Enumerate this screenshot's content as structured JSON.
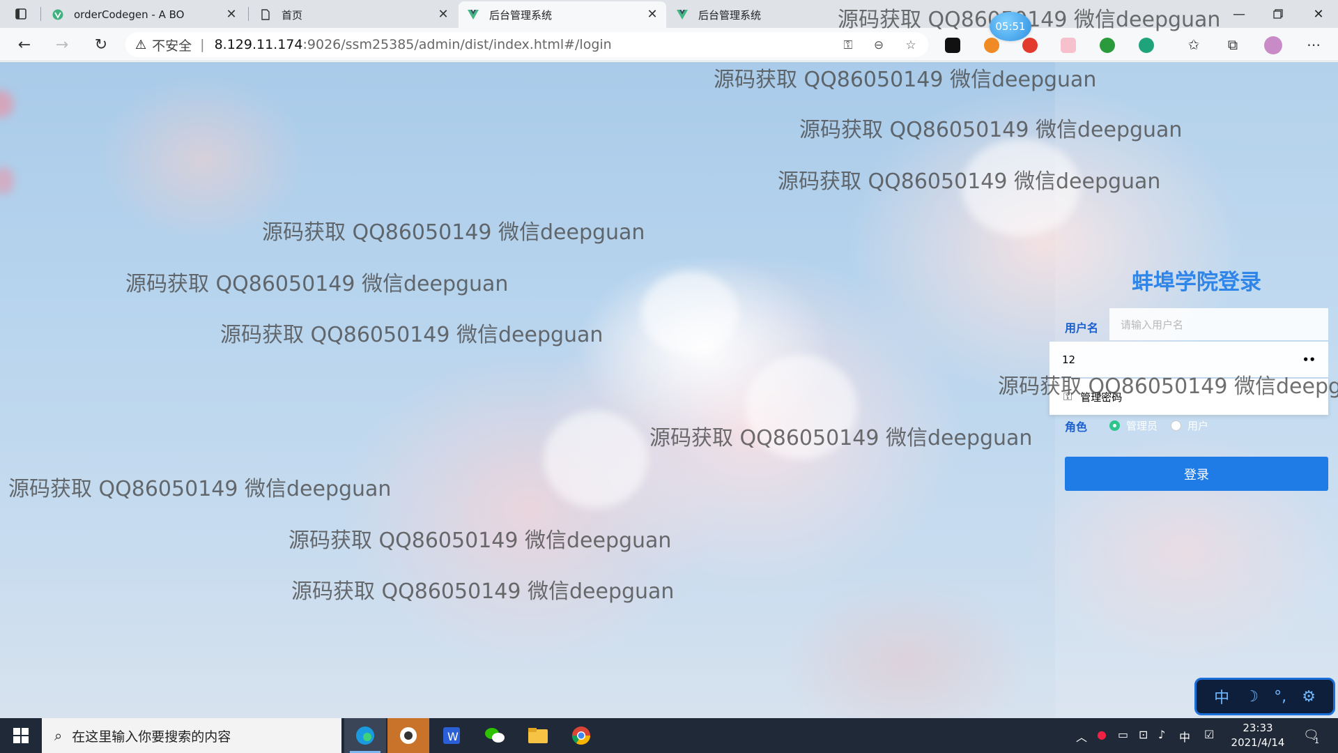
{
  "browser": {
    "tabs": [
      {
        "title": "orderCodegen - A BO",
        "active": false
      },
      {
        "title": "首页",
        "active": false
      },
      {
        "title": "后台管理系统",
        "active": true
      },
      {
        "title": "后台管理系统",
        "active": false
      }
    ],
    "url": {
      "security_label": "不安全",
      "host": "8.129.11.174",
      "rest": ":9026/ssm25385/admin/dist/index.html#/login"
    },
    "timer": "05:51"
  },
  "watermark": "源码获取 QQ86050149 微信deepguan",
  "login": {
    "title": "蚌埠学院登录",
    "username_label": "用户名",
    "username_placeholder": "请输入用户名",
    "password_value": "12",
    "password_suggest": "管理密码",
    "role_label": "角色",
    "roles": [
      {
        "label": "管理员",
        "checked": true
      },
      {
        "label": "用户",
        "checked": false
      }
    ],
    "submit": "登录"
  },
  "ime": {
    "mode": "中"
  },
  "taskbar": {
    "search_placeholder": "在这里输入你要搜索的内容",
    "tray_lang": "中",
    "time": "23:33",
    "date": "2021/4/14",
    "notification_count": "1"
  },
  "colors": {
    "accent": "#1f7be6",
    "title": "#2f86e8",
    "label": "#1a5fcf",
    "radio_checked": "#2fc48d"
  }
}
